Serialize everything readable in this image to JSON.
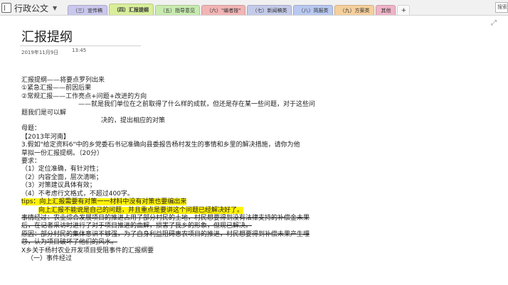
{
  "notebook": {
    "name": "行政公文"
  },
  "tabs": [
    {
      "label": "（三）宣传稿",
      "color": "#c9c7ec"
    },
    {
      "label": "（四）汇报提纲",
      "color": "#d9ee9a",
      "active": true
    },
    {
      "label": "（五）指导意见",
      "color": "#c8ebb0"
    },
    {
      "label": "（六）\"编者按\"",
      "color": "#f2b5b5"
    },
    {
      "label": "（七）新闻稿类",
      "color": "#c4cbe9"
    },
    {
      "label": "（八）简报类",
      "color": "#b8c8f0"
    },
    {
      "label": "（九）方案类",
      "color": "#f5cf9c"
    },
    {
      "label": "其他",
      "color": "#efb4c7"
    },
    {
      "label": "+",
      "color": "#fafafa"
    }
  ],
  "search": {
    "placeholder": "搜索"
  },
  "page": {
    "title": "汇报提纲",
    "date": "2019年11月9日",
    "time": "13:45"
  },
  "content": {
    "l1": "汇报提纲——将要点罗列出来",
    "l2": "①紧急汇报——前因后果",
    "l3": "②常规汇报——工作亮点+问题+改进的方向",
    "l4": "——就是我们单位在之前取得了什么样的成就，但还是存在某一些问题，对于这些问",
    "l5": "题我们是可以解",
    "l6": "决的，提出相应的对策",
    "l7": "母题：",
    "l8": "【2013年河南】",
    "l9": "3.假如\"给定资料6\"中的乡党委石书记准确向县委报告杨村发生的事情和乡里的解决措施，请你为他",
    "l10": "草拟一份汇报提纲。（20分）",
    "l11": "要求：",
    "l12": "（1）定位准确，有针对性；",
    "l13": "（2）内容全面，层次清晰；",
    "l14": "（3）对策建议具体有效；",
    "l15": "（4）不考虑行文格式，不超过400字。",
    "l16": "tips：向上汇报需要有对策一一材料中没有对策也要编出来",
    "l17": "向上汇报不能说是自己的问题，并且重点是要讲这个问题已经解决好了。",
    "l18": "事情经过：农业综合发展项目的推进占用了部分村民的土地，村民想要得到没有法律支持的补偿金未果",
    "l19": "后，在记者采访时进行了对于项目推进的曲解，损害了我乡的形象，但现已解决。",
    "l20": "原因：部分村民的集体意识不够强，为了自身利益阻碍惠农项目的推进，村民想要得到补偿未果产生埋",
    "l21": "怨，认为项目破坏了他们的风水。",
    "l22": "X乡关于杨村农业开发项目受阻事件的汇报纲要",
    "l23": "（一）事件经过"
  }
}
